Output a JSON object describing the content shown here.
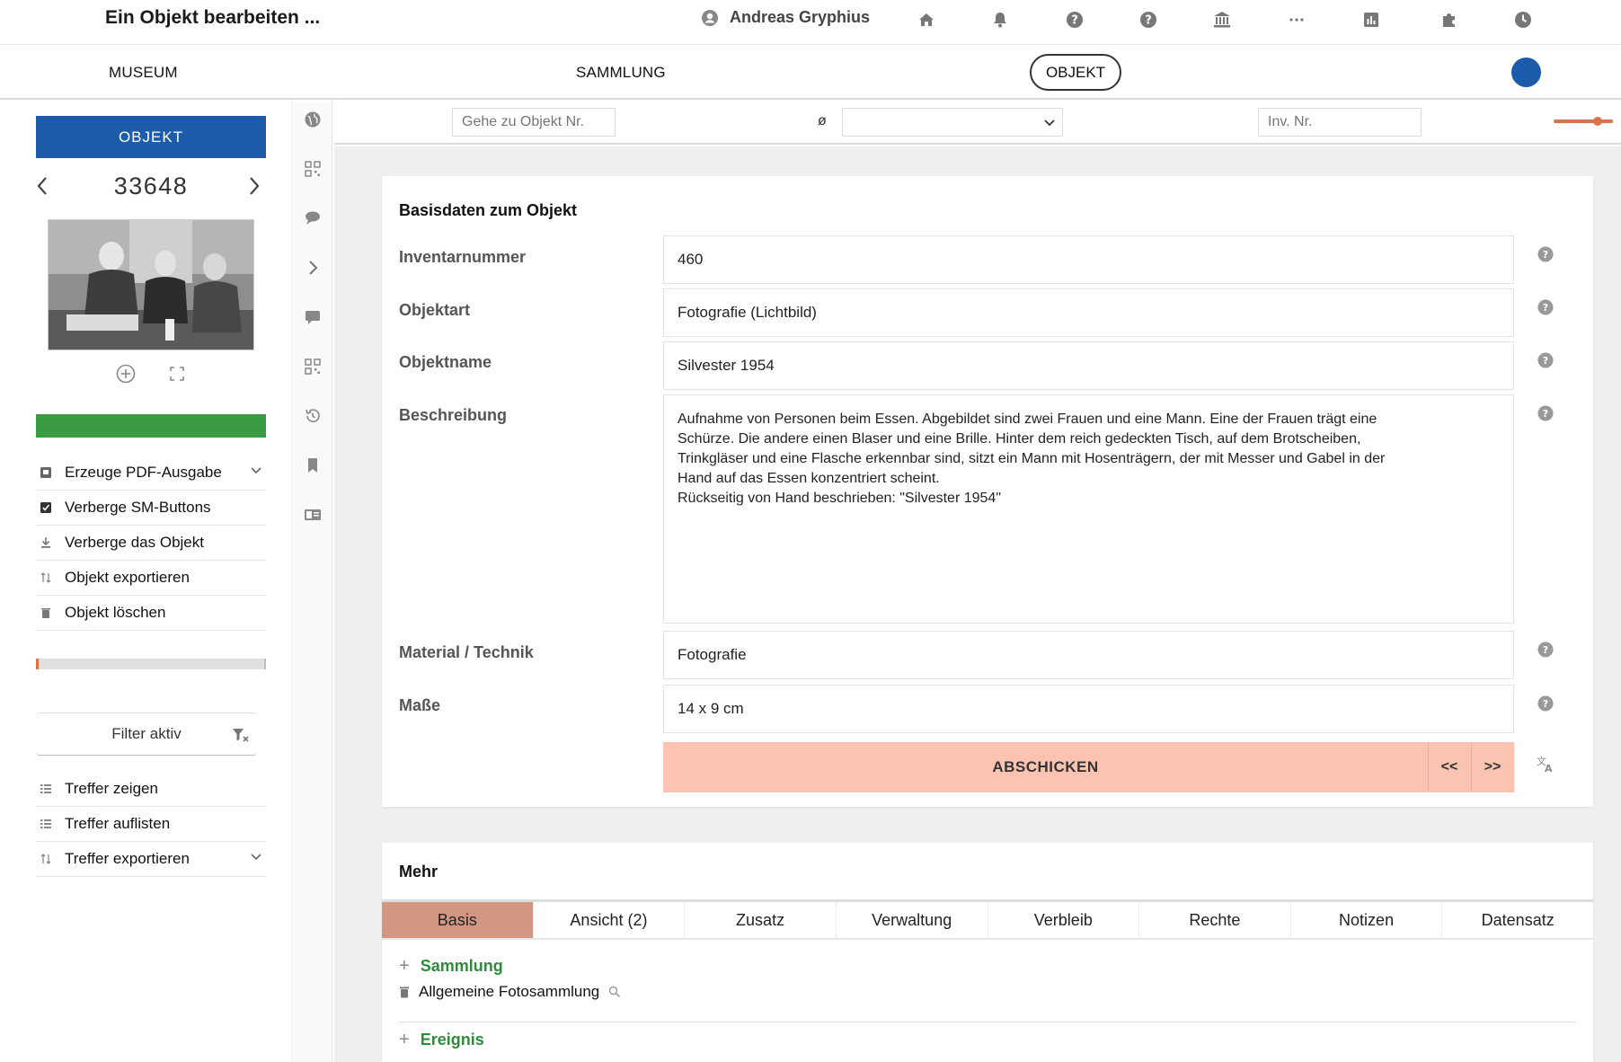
{
  "header": {
    "title": "Ein Objekt bearbeiten ...",
    "user_name": "Andreas Gryphius"
  },
  "nav": {
    "museum": "MUSEUM",
    "sammlung": "SAMMLUNG",
    "objekt": "OBJEKT"
  },
  "sidebar": {
    "objekt_button": "OBJEKT",
    "object_number": "33648",
    "actions": [
      {
        "label": "Erzeuge PDF-Ausgabe",
        "icon": "pdf-icon",
        "has_chevron": true
      },
      {
        "label": "Verberge SM-Buttons",
        "icon": "checkbox-icon",
        "has_chevron": false
      },
      {
        "label": "Verberge das Objekt",
        "icon": "download-icon",
        "has_chevron": false
      },
      {
        "label": "Objekt exportieren",
        "icon": "sort-icon",
        "has_chevron": false
      },
      {
        "label": "Objekt löschen",
        "icon": "trash-icon",
        "has_chevron": false
      }
    ],
    "filter_label": "Filter aktiv",
    "results": [
      {
        "label": "Treffer zeigen",
        "icon": "list-icon"
      },
      {
        "label": "Treffer auflisten",
        "icon": "list-icon"
      },
      {
        "label": "Treffer exportieren",
        "icon": "sort-icon",
        "has_chevron": true
      }
    ]
  },
  "searchbar": {
    "goto_placeholder": "Gehe zu Objekt Nr.",
    "separator": "ø",
    "inv_placeholder": "Inv. Nr."
  },
  "basisdaten": {
    "title": "Basisdaten zum Objekt",
    "fields": [
      {
        "label": "Inventarnummer",
        "value": "460"
      },
      {
        "label": "Objektart",
        "value": "Fotografie (Lichtbild)"
      },
      {
        "label": "Objektname",
        "value": "Silvester 1954"
      },
      {
        "label": "Beschreibung",
        "value": "Aufnahme von Personen beim Essen. Abgebildet sind zwei Frauen und eine Mann. Eine der Frauen trägt eine\nSchürze. Die andere einen Blaser und eine Brille. Hinter dem reich gedeckten Tisch, auf dem Brotscheiben,\nTrinkgläser und eine Flasche erkennbar sind, sitzt ein Mann mit Hosenträgern, der mit Messer und Gabel in der\nHand auf das Essen konzentriert scheint.\nRückseitig von Hand beschrieben: \"Silvester 1954\""
      },
      {
        "label": "Material / Technik",
        "value": "Fotografie"
      },
      {
        "label": "Maße",
        "value": "14 x 9 cm"
      }
    ],
    "submit_label": "ABSCHICKEN",
    "prev_label": "<<",
    "next_label": ">>"
  },
  "mehr": {
    "title": "Mehr",
    "tabs": [
      "Basis",
      "Ansicht (2)",
      "Zusatz",
      "Verwaltung",
      "Verbleib",
      "Rechte",
      "Notizen",
      "Datensatz"
    ],
    "active_tab": "Basis",
    "sections": [
      {
        "name": "Sammlung"
      },
      {
        "name": "Ereignis"
      }
    ],
    "sammlung_entry": "Allgemeine Fotosammlung"
  },
  "colors": {
    "primary_blue": "#1c5cab",
    "progress_green": "#3a9b43",
    "submit_salmon": "#fcc4b0",
    "active_tab": "#d39683",
    "section_green": "#2e8b3a",
    "slider_orange": "#d9734a"
  }
}
